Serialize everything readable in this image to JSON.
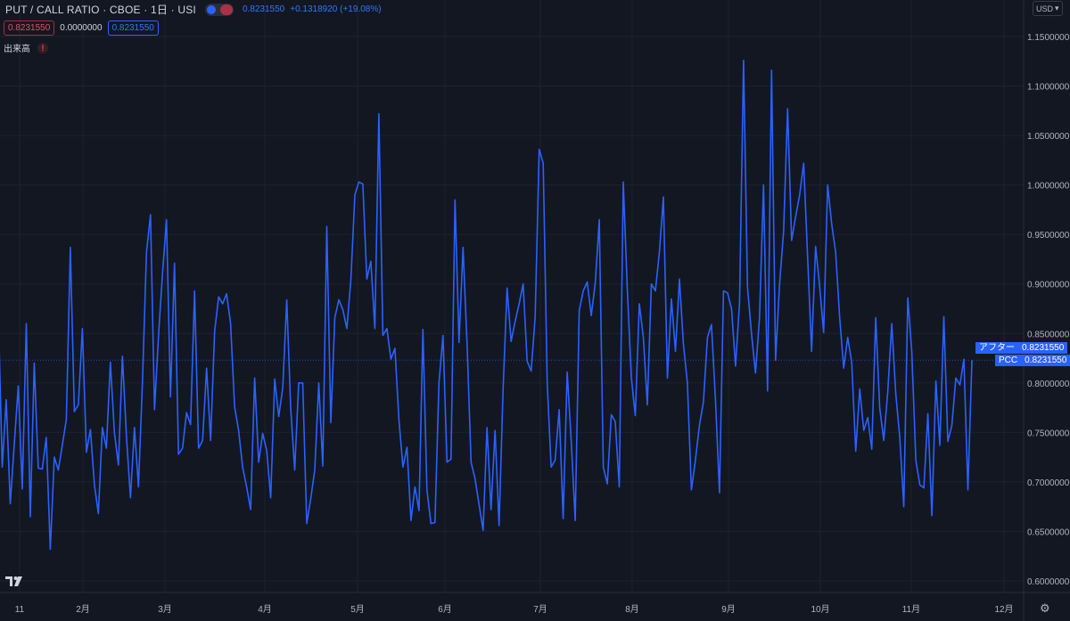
{
  "header": {
    "symbol": "PUT / CALL RATIO · CBOE · 1日 · USI",
    "last": "0.8231550",
    "change": "+0.1318920 (+19.08%)",
    "bid": "0.8231550",
    "spread": "0.0000000",
    "ask": "0.8231550",
    "volume_label": "出来高",
    "warning_glyph": "!"
  },
  "currency": "USD",
  "tags": [
    {
      "label": "アフター",
      "value": "0.8231550"
    },
    {
      "label": "PCC",
      "value": "0.8231550"
    }
  ],
  "colors": {
    "background": "#131722",
    "grid": "#1e222d",
    "line": "#2962ff",
    "last_line": "#2962ff",
    "axis_text": "#b2b5be",
    "border": "#2a2e39"
  },
  "chart_data": {
    "type": "line",
    "ylim": [
      0.6,
      1.15
    ],
    "y_ticks": [
      "0.6000000",
      "0.6500000",
      "0.7000000",
      "0.7500000",
      "0.8000000",
      "0.8500000",
      "0.9000000",
      "0.9500000",
      "1.0000000",
      "1.0500000",
      "1.1000000",
      "1.1500000"
    ],
    "x_ticks": [
      "11",
      "2月",
      "3月",
      "4月",
      "5月",
      "6月",
      "7月",
      "8月",
      "9月",
      "10月",
      "11月",
      "12月"
    ],
    "series": [
      {
        "values": [
          0.875,
          0.715,
          0.783,
          0.678,
          0.738,
          0.797,
          0.693,
          0.86,
          0.665,
          0.82,
          0.714,
          0.713,
          0.745,
          0.632,
          0.725,
          0.712,
          0.737,
          0.763,
          0.937,
          0.771,
          0.778,
          0.855,
          0.73,
          0.753,
          0.697,
          0.668,
          0.755,
          0.734,
          0.821,
          0.75,
          0.717,
          0.827,
          0.746,
          0.684,
          0.755,
          0.695,
          0.802,
          0.932,
          0.97,
          0.773,
          0.848,
          0.91,
          0.965,
          0.786,
          0.921,
          0.728,
          0.734,
          0.77,
          0.758,
          0.893,
          0.734,
          0.742,
          0.815,
          0.742,
          0.852,
          0.887,
          0.88,
          0.89,
          0.86,
          0.776,
          0.752,
          0.715,
          0.695,
          0.672,
          0.805,
          0.72,
          0.749,
          0.732,
          0.684,
          0.804,
          0.766,
          0.795,
          0.884,
          0.775,
          0.712,
          0.8,
          0.8,
          0.658,
          0.683,
          0.712,
          0.8,
          0.716,
          0.958,
          0.76,
          0.866,
          0.884,
          0.874,
          0.855,
          0.904,
          0.99,
          1.003,
          1.001,
          0.905,
          0.923,
          0.855,
          1.072,
          0.848,
          0.855,
          0.824,
          0.835,
          0.763,
          0.715,
          0.735,
          0.661,
          0.695,
          0.671,
          0.854,
          0.692,
          0.658,
          0.659,
          0.8,
          0.848,
          0.72,
          0.723,
          0.985,
          0.841,
          0.937,
          0.84,
          0.72,
          0.703,
          0.677,
          0.651,
          0.755,
          0.672,
          0.752,
          0.656,
          0.793,
          0.896,
          0.842,
          0.862,
          0.88,
          0.9,
          0.822,
          0.812,
          0.867,
          1.036,
          1.022,
          0.8,
          0.715,
          0.722,
          0.773,
          0.663,
          0.811,
          0.742,
          0.661,
          0.873,
          0.893,
          0.902,
          0.868,
          0.901,
          0.965,
          0.715,
          0.698,
          0.768,
          0.761,
          0.695,
          1.003,
          0.895,
          0.806,
          0.767,
          0.88,
          0.846,
          0.778,
          0.9,
          0.893,
          0.932,
          0.988,
          0.805,
          0.885,
          0.832,
          0.905,
          0.84,
          0.8,
          0.692,
          0.722,
          0.757,
          0.781,
          0.846,
          0.859,
          0.783,
          0.689,
          0.893,
          0.891,
          0.875,
          0.817,
          0.881,
          1.126,
          0.897,
          0.85,
          0.81,
          0.866,
          1.0,
          0.792,
          1.116,
          0.823,
          0.9,
          0.953,
          1.077,
          0.944,
          0.968,
          0.99,
          1.022,
          0.926,
          0.832,
          0.938,
          0.898,
          0.851,
          1.0,
          0.961,
          0.932,
          0.866,
          0.815,
          0.846,
          0.821,
          0.731,
          0.794,
          0.752,
          0.765,
          0.733,
          0.866,
          0.775,
          0.742,
          0.791,
          0.86,
          0.789,
          0.745,
          0.675,
          0.886,
          0.831,
          0.722,
          0.697,
          0.694,
          0.769,
          0.666,
          0.802,
          0.737,
          0.867,
          0.741,
          0.757,
          0.805,
          0.798,
          0.824,
          0.692,
          0.823
        ]
      }
    ]
  }
}
